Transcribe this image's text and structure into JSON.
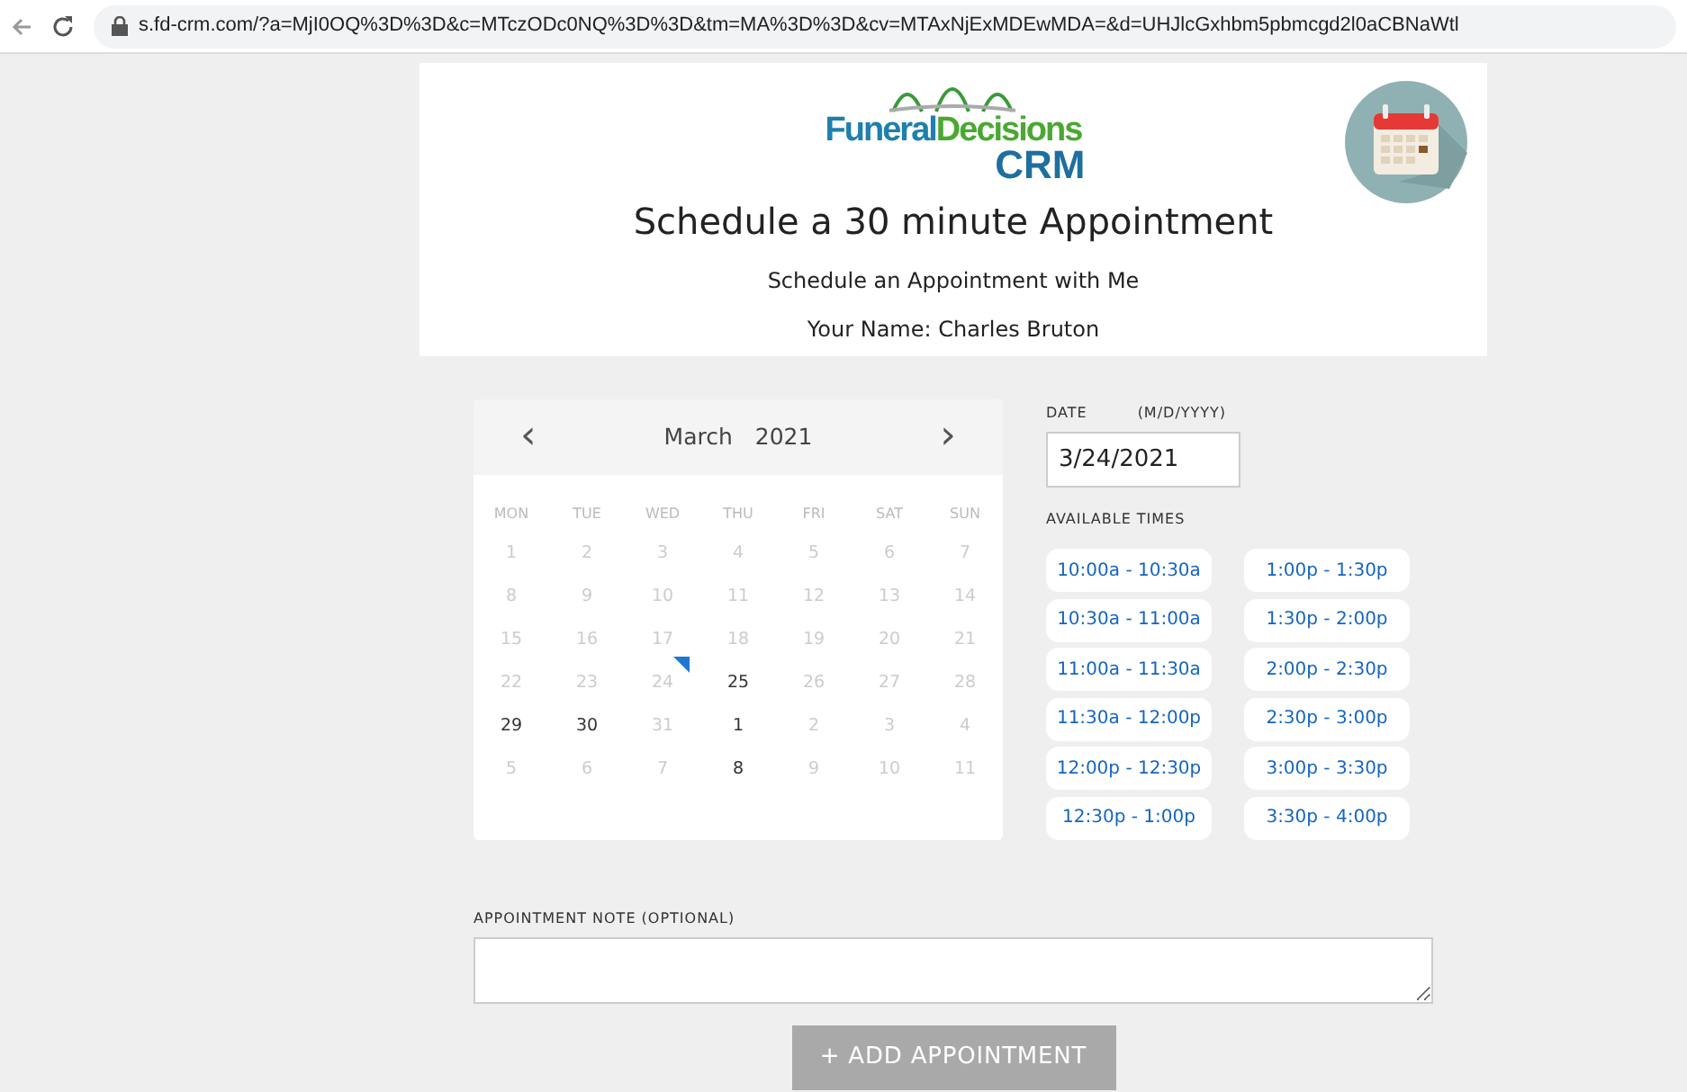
{
  "browser": {
    "url": "s.fd-crm.com/?a=MjI0OQ%3D%3D&c=MTczODc0NQ%3D%3D&tm=MA%3D%3D&cv=MTAxNjExMDEwMDA=&d=UHJlcGxhbm5pbmcgd2l0aCBNaWtl"
  },
  "header": {
    "logo_main": "Funeral",
    "logo_accent": "Decisions",
    "logo_sub": "CRM",
    "title": "Schedule a 30 minute Appointment",
    "subtitle": "Schedule an Appointment with Me",
    "name_line": "Your Name: Charles Bruton"
  },
  "calendar": {
    "prev": "‹",
    "month": "March",
    "year": "2021",
    "next": "›",
    "weekdays": [
      "MON",
      "TUE",
      "WED",
      "THU",
      "FRI",
      "SAT",
      "SUN"
    ],
    "weeks": [
      [
        {
          "day": "1",
          "enabled": false,
          "selected": false
        },
        {
          "day": "2",
          "enabled": false,
          "selected": false
        },
        {
          "day": "3",
          "enabled": false,
          "selected": false
        },
        {
          "day": "4",
          "enabled": false,
          "selected": false
        },
        {
          "day": "5",
          "enabled": false,
          "selected": false
        },
        {
          "day": "6",
          "enabled": false,
          "selected": false
        },
        {
          "day": "7",
          "enabled": false,
          "selected": false
        }
      ],
      [
        {
          "day": "8",
          "enabled": false,
          "selected": false
        },
        {
          "day": "9",
          "enabled": false,
          "selected": false
        },
        {
          "day": "10",
          "enabled": false,
          "selected": false
        },
        {
          "day": "11",
          "enabled": false,
          "selected": false
        },
        {
          "day": "12",
          "enabled": false,
          "selected": false
        },
        {
          "day": "13",
          "enabled": false,
          "selected": false
        },
        {
          "day": "14",
          "enabled": false,
          "selected": false
        }
      ],
      [
        {
          "day": "15",
          "enabled": false,
          "selected": false
        },
        {
          "day": "16",
          "enabled": false,
          "selected": false
        },
        {
          "day": "17",
          "enabled": false,
          "selected": false
        },
        {
          "day": "18",
          "enabled": false,
          "selected": false
        },
        {
          "day": "19",
          "enabled": false,
          "selected": false
        },
        {
          "day": "20",
          "enabled": false,
          "selected": false
        },
        {
          "day": "21",
          "enabled": false,
          "selected": false
        }
      ],
      [
        {
          "day": "22",
          "enabled": false,
          "selected": false
        },
        {
          "day": "23",
          "enabled": false,
          "selected": false
        },
        {
          "day": "24",
          "enabled": false,
          "selected": true
        },
        {
          "day": "25",
          "enabled": true,
          "selected": false
        },
        {
          "day": "26",
          "enabled": false,
          "selected": false
        },
        {
          "day": "27",
          "enabled": false,
          "selected": false
        },
        {
          "day": "28",
          "enabled": false,
          "selected": false
        }
      ],
      [
        {
          "day": "29",
          "enabled": true,
          "selected": false
        },
        {
          "day": "30",
          "enabled": true,
          "selected": false
        },
        {
          "day": "31",
          "enabled": false,
          "selected": false
        },
        {
          "day": "1",
          "enabled": true,
          "selected": false
        },
        {
          "day": "2",
          "enabled": false,
          "selected": false
        },
        {
          "day": "3",
          "enabled": false,
          "selected": false
        },
        {
          "day": "4",
          "enabled": false,
          "selected": false
        }
      ],
      [
        {
          "day": "5",
          "enabled": false,
          "selected": false
        },
        {
          "day": "6",
          "enabled": false,
          "selected": false
        },
        {
          "day": "7",
          "enabled": false,
          "selected": false
        },
        {
          "day": "8",
          "enabled": true,
          "selected": false
        },
        {
          "day": "9",
          "enabled": false,
          "selected": false
        },
        {
          "day": "10",
          "enabled": false,
          "selected": false
        },
        {
          "day": "11",
          "enabled": false,
          "selected": false
        }
      ]
    ]
  },
  "date_field": {
    "label": "DATE",
    "format": "(M/D/YYYY)",
    "value": "3/24/2021"
  },
  "times": {
    "label": "AVAILABLE TIMES",
    "columns": [
      [
        "10:00a - 10:30a",
        "10:30a - 11:00a",
        "11:00a - 11:30a",
        "11:30a - 12:00p",
        "12:00p - 12:30p",
        "12:30p - 1:00p"
      ],
      [
        "1:00p - 1:30p",
        "1:30p - 2:00p",
        "2:00p - 2:30p",
        "2:30p - 3:00p",
        "3:00p - 3:30p",
        "3:30p - 4:00p"
      ]
    ]
  },
  "note": {
    "label": "APPOINTMENT NOTE (OPTIONAL)"
  },
  "submit": {
    "label": "+ ADD APPOINTMENT",
    "disabled": true
  }
}
